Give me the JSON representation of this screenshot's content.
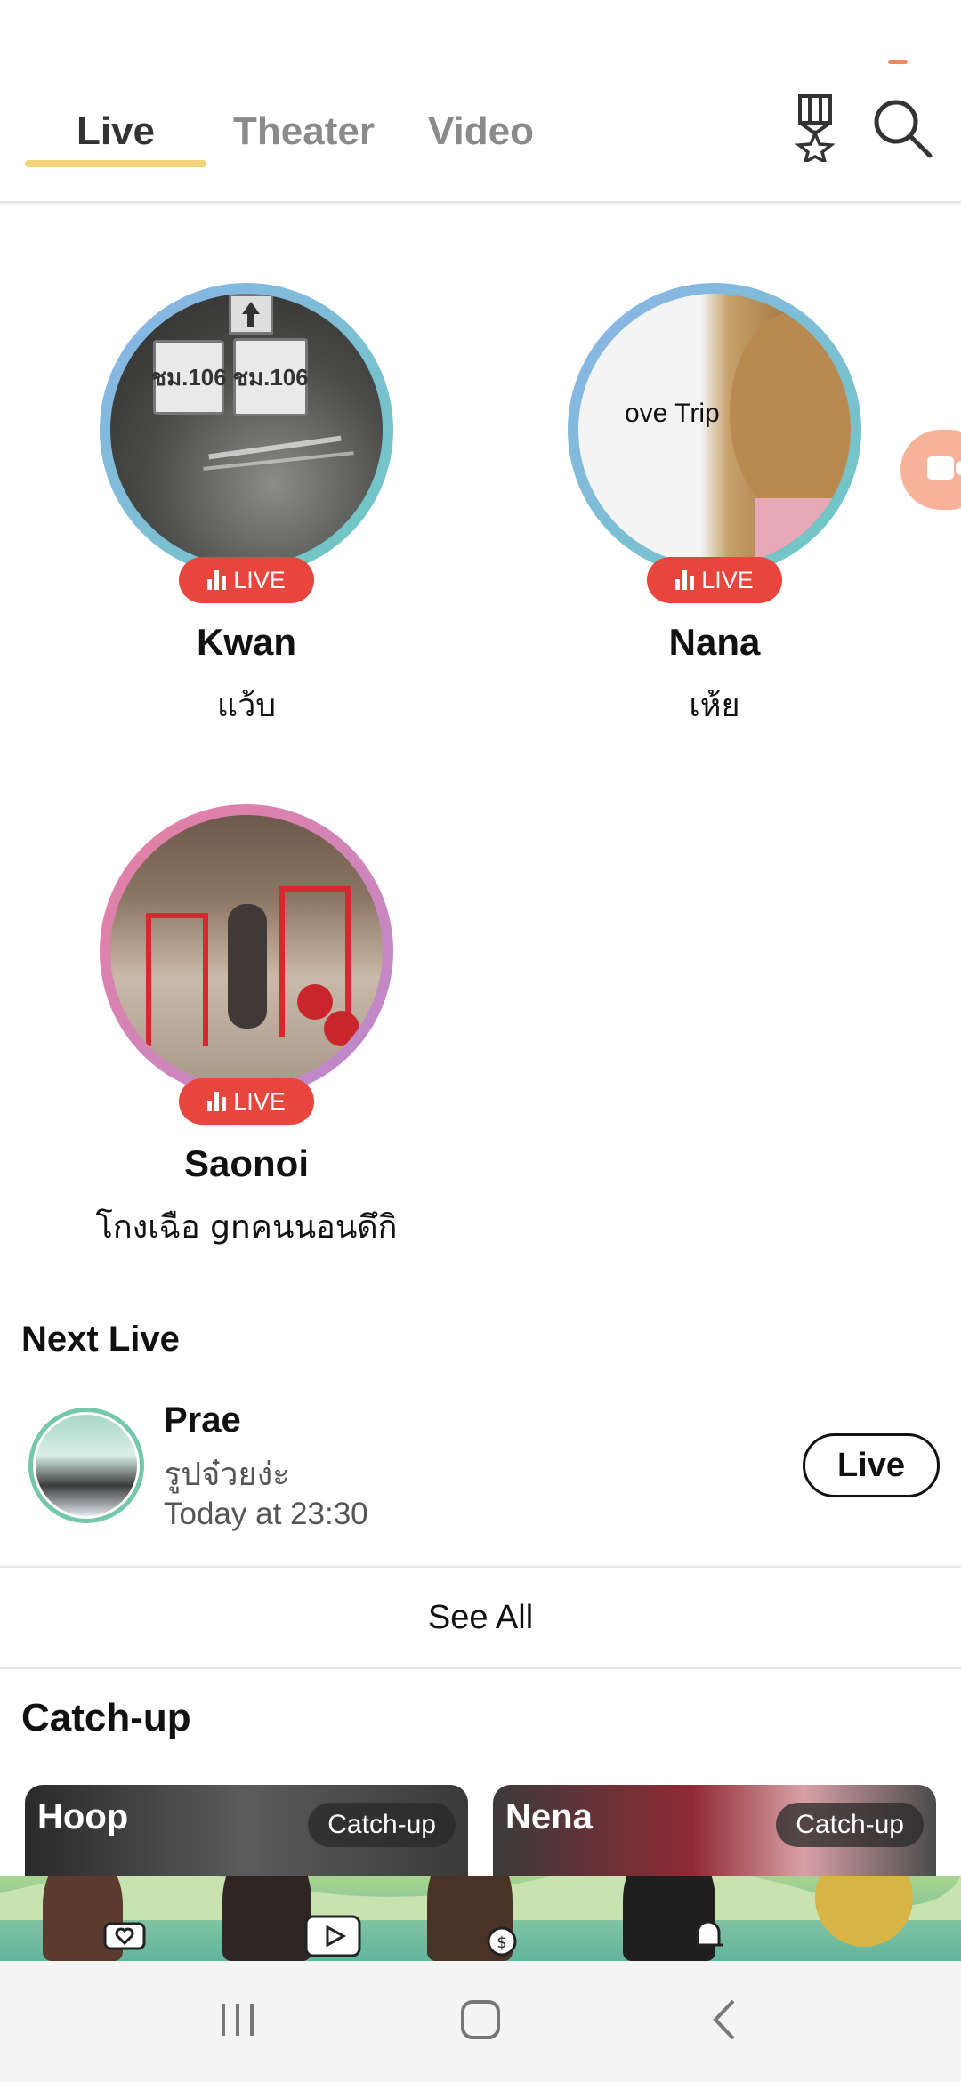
{
  "header": {
    "tabs": [
      {
        "label": "Live",
        "active": true
      },
      {
        "label": "Theater",
        "active": false
      },
      {
        "label": "Video",
        "active": false
      }
    ],
    "icons": [
      "trophy-icon",
      "search-icon"
    ],
    "accent_color": "#f4d47a"
  },
  "live": {
    "badge_label": "LIVE",
    "cards": [
      {
        "name": "Kwan",
        "status": "แว้บ",
        "ring": "blue"
      },
      {
        "name": "Nana",
        "status": "เห้ย",
        "ring": "blue",
        "image_text": "ove Trip"
      },
      {
        "name": "Saonoi",
        "status": "โกงเฉือ gnคนนอนดึกิ",
        "ring": "pink"
      }
    ]
  },
  "kwan_signs": [
    "ชม.106",
    "ชม.106"
  ],
  "next_live": {
    "title": "Next Live",
    "item": {
      "name": "Prae",
      "description": "รูปจ๋วยง่ะ",
      "time": "Today at 23:30",
      "button_label": "Live"
    },
    "see_all": "See All"
  },
  "catch_up": {
    "title": "Catch-up",
    "cards": [
      {
        "name": "Hoop",
        "badge": "Catch-up"
      },
      {
        "name": "Nena",
        "badge": "Catch-up"
      }
    ]
  },
  "colors": {
    "live_badge": "#e8453c",
    "float_button": "#f7b39a",
    "next_avatar_ring": "#74c7a8"
  }
}
